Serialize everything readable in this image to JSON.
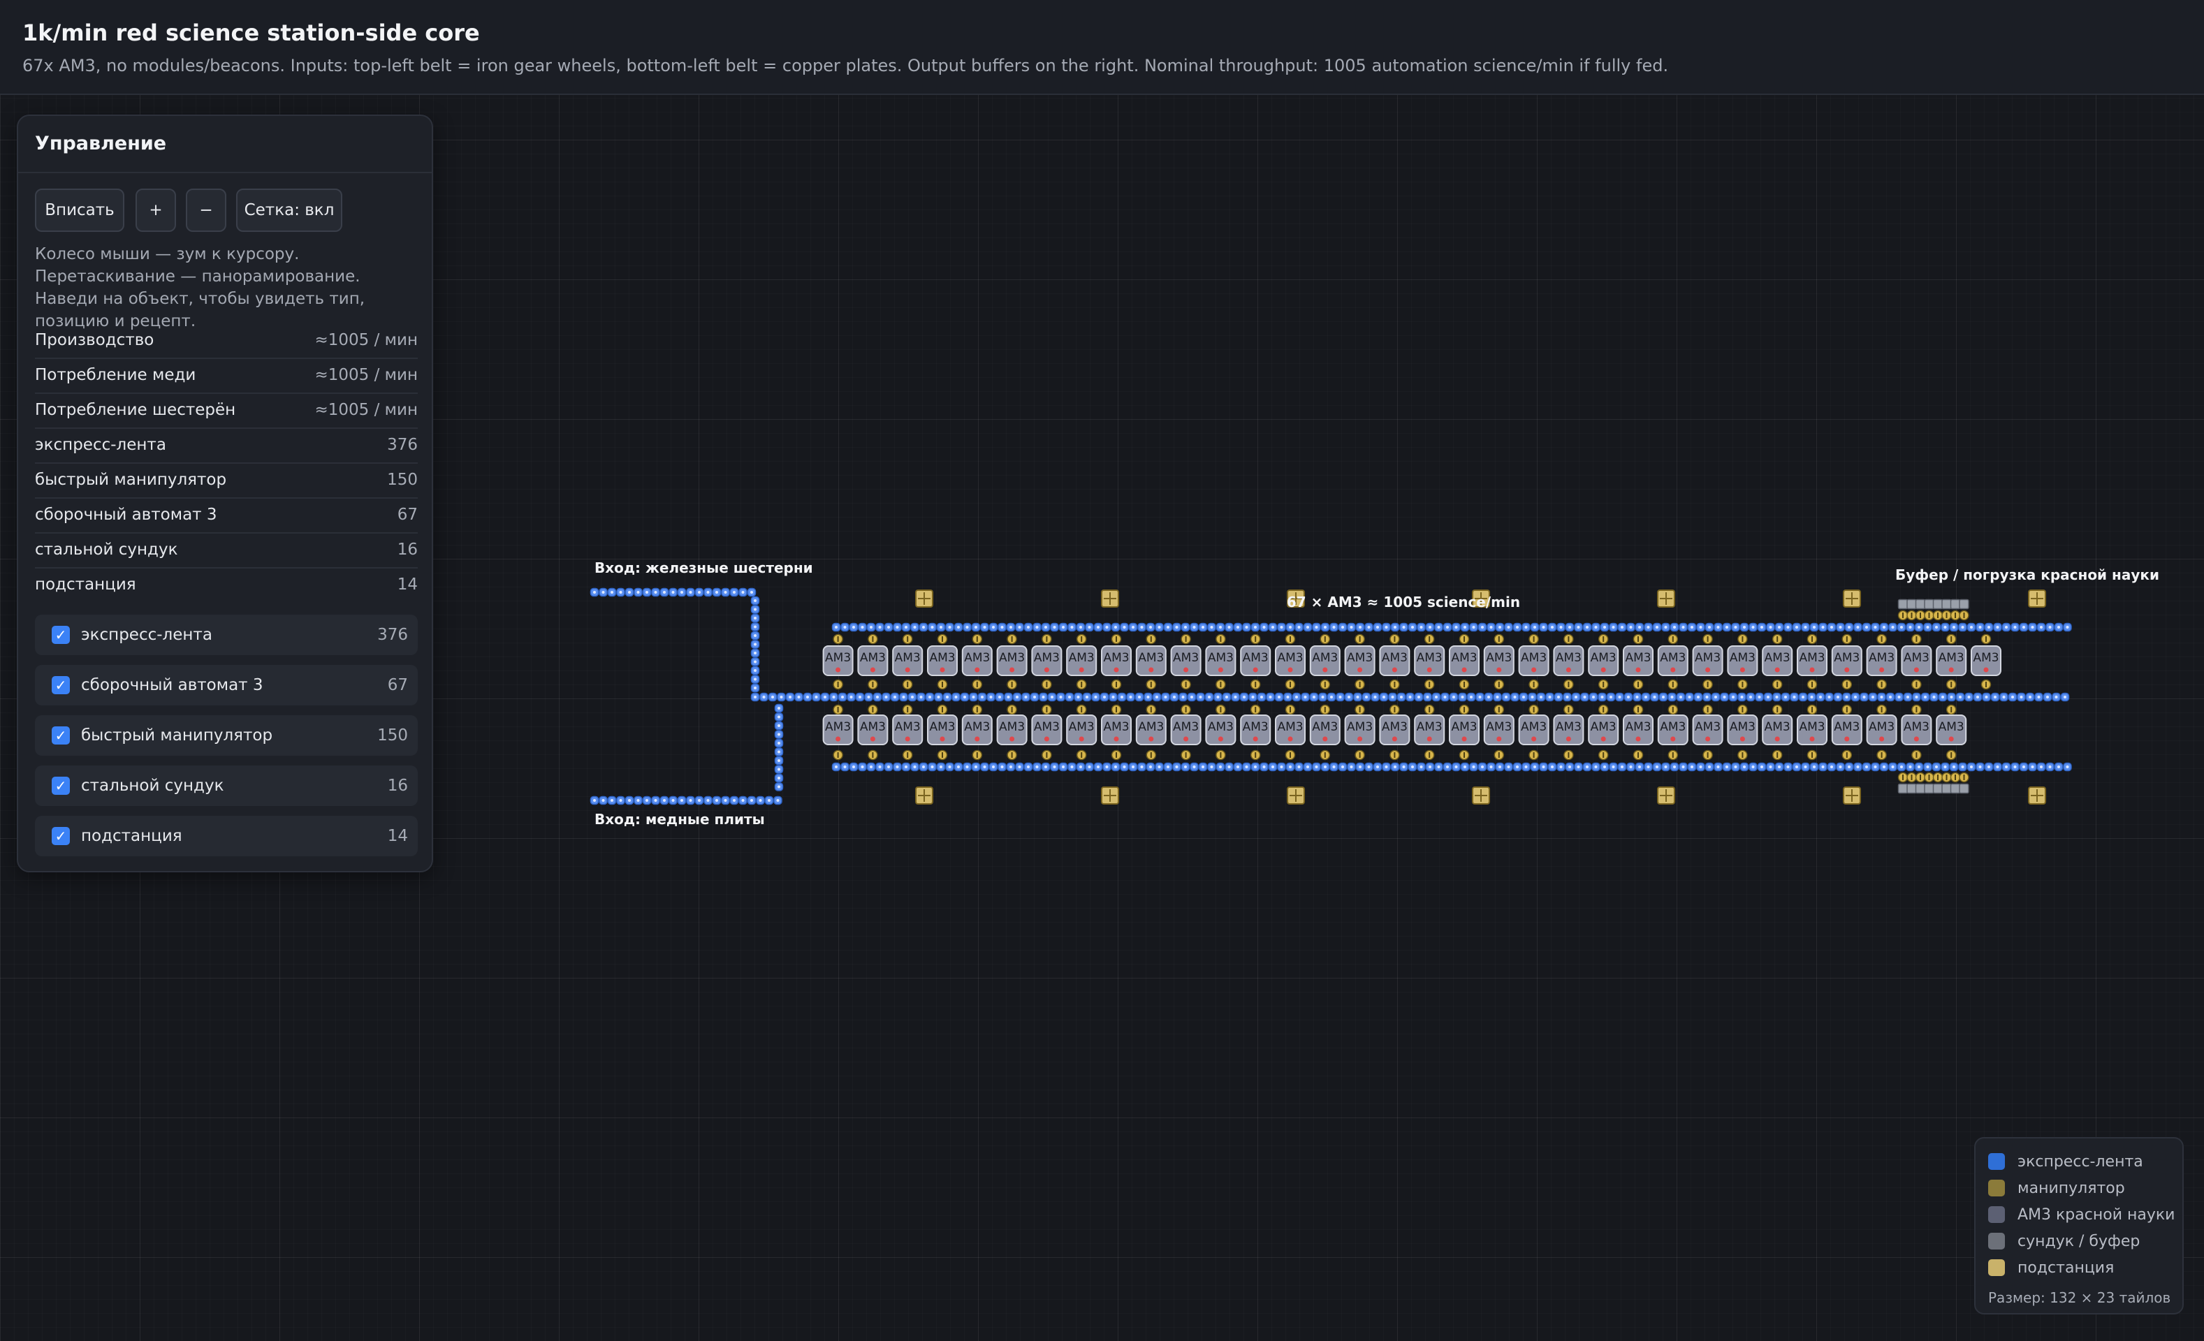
{
  "header": {
    "title": "1k/min red science station-side core",
    "subtitle": "67x AM3, no modules/beacons. Inputs: top-left belt = iron gear wheels, bottom-left belt = copper plates. Output buffers on the right. Nominal throughput: 1005 automation science/min if fully fed."
  },
  "panel": {
    "title": "Управление",
    "buttons": {
      "fit": "Вписать",
      "zoom_in": "+",
      "zoom_out": "−",
      "grid": "Сетка: вкл"
    },
    "hint": "Колесо мыши — зум к курсору. Перетаскивание — панорамирование. Наведи на объект, чтобы увидеть тип, позицию и рецепт.",
    "stats": [
      {
        "label": "Производство",
        "value": "≈1005 / мин"
      },
      {
        "label": "Потребление меди",
        "value": "≈1005 / мин"
      },
      {
        "label": "Потребление шестерён",
        "value": "≈1005 / мин"
      },
      {
        "label": "экспресс-лента",
        "value": "376"
      },
      {
        "label": "быстрый манипулятор",
        "value": "150"
      },
      {
        "label": "сборочный автомат 3",
        "value": "67"
      },
      {
        "label": "стальной сундук",
        "value": "16"
      },
      {
        "label": "подстанция",
        "value": "14"
      }
    ],
    "toggles": [
      {
        "label": "экспресс-лента",
        "count": "376",
        "checked": true
      },
      {
        "label": "сборочный автомат 3",
        "count": "67",
        "checked": true
      },
      {
        "label": "быстрый манипулятор",
        "count": "150",
        "checked": true
      },
      {
        "label": "стальной сундук",
        "count": "16",
        "checked": true
      },
      {
        "label": "подстанция",
        "count": "14",
        "checked": true
      }
    ]
  },
  "diagram": {
    "labels": {
      "iron_input": "Вход: железные шестерни",
      "copper_input": "Вход: медные плиты",
      "center": "67 × AM3 ≈ 1005 science/min",
      "buffer": "Буфер / погрузка красной науки"
    },
    "machine_label": "AM3",
    "rows": {
      "top_machines": 34,
      "bottom_machines": 33
    },
    "substations_per_side": 7
  },
  "legend": {
    "items": [
      {
        "label": "экспресс-лента",
        "color": "#2f6fd6"
      },
      {
        "label": "манипулятор",
        "color": "#8b7b3a"
      },
      {
        "label": "AM3 красной науки",
        "color": "#5c6073"
      },
      {
        "label": "сундук / буфер",
        "color": "#6c7079"
      },
      {
        "label": "подстанция",
        "color": "#c9b26a"
      }
    ],
    "size": "Размер: 132 × 23 тайлов"
  },
  "colors": {
    "belt": "#5a8ff0",
    "belt_border": "#2e64c8",
    "inserter": "#d8b64c",
    "machine": "#8d91a3",
    "machine_dot": "#e0484c",
    "chest": "#9aa0aa",
    "substation": "#d6bd6e"
  }
}
